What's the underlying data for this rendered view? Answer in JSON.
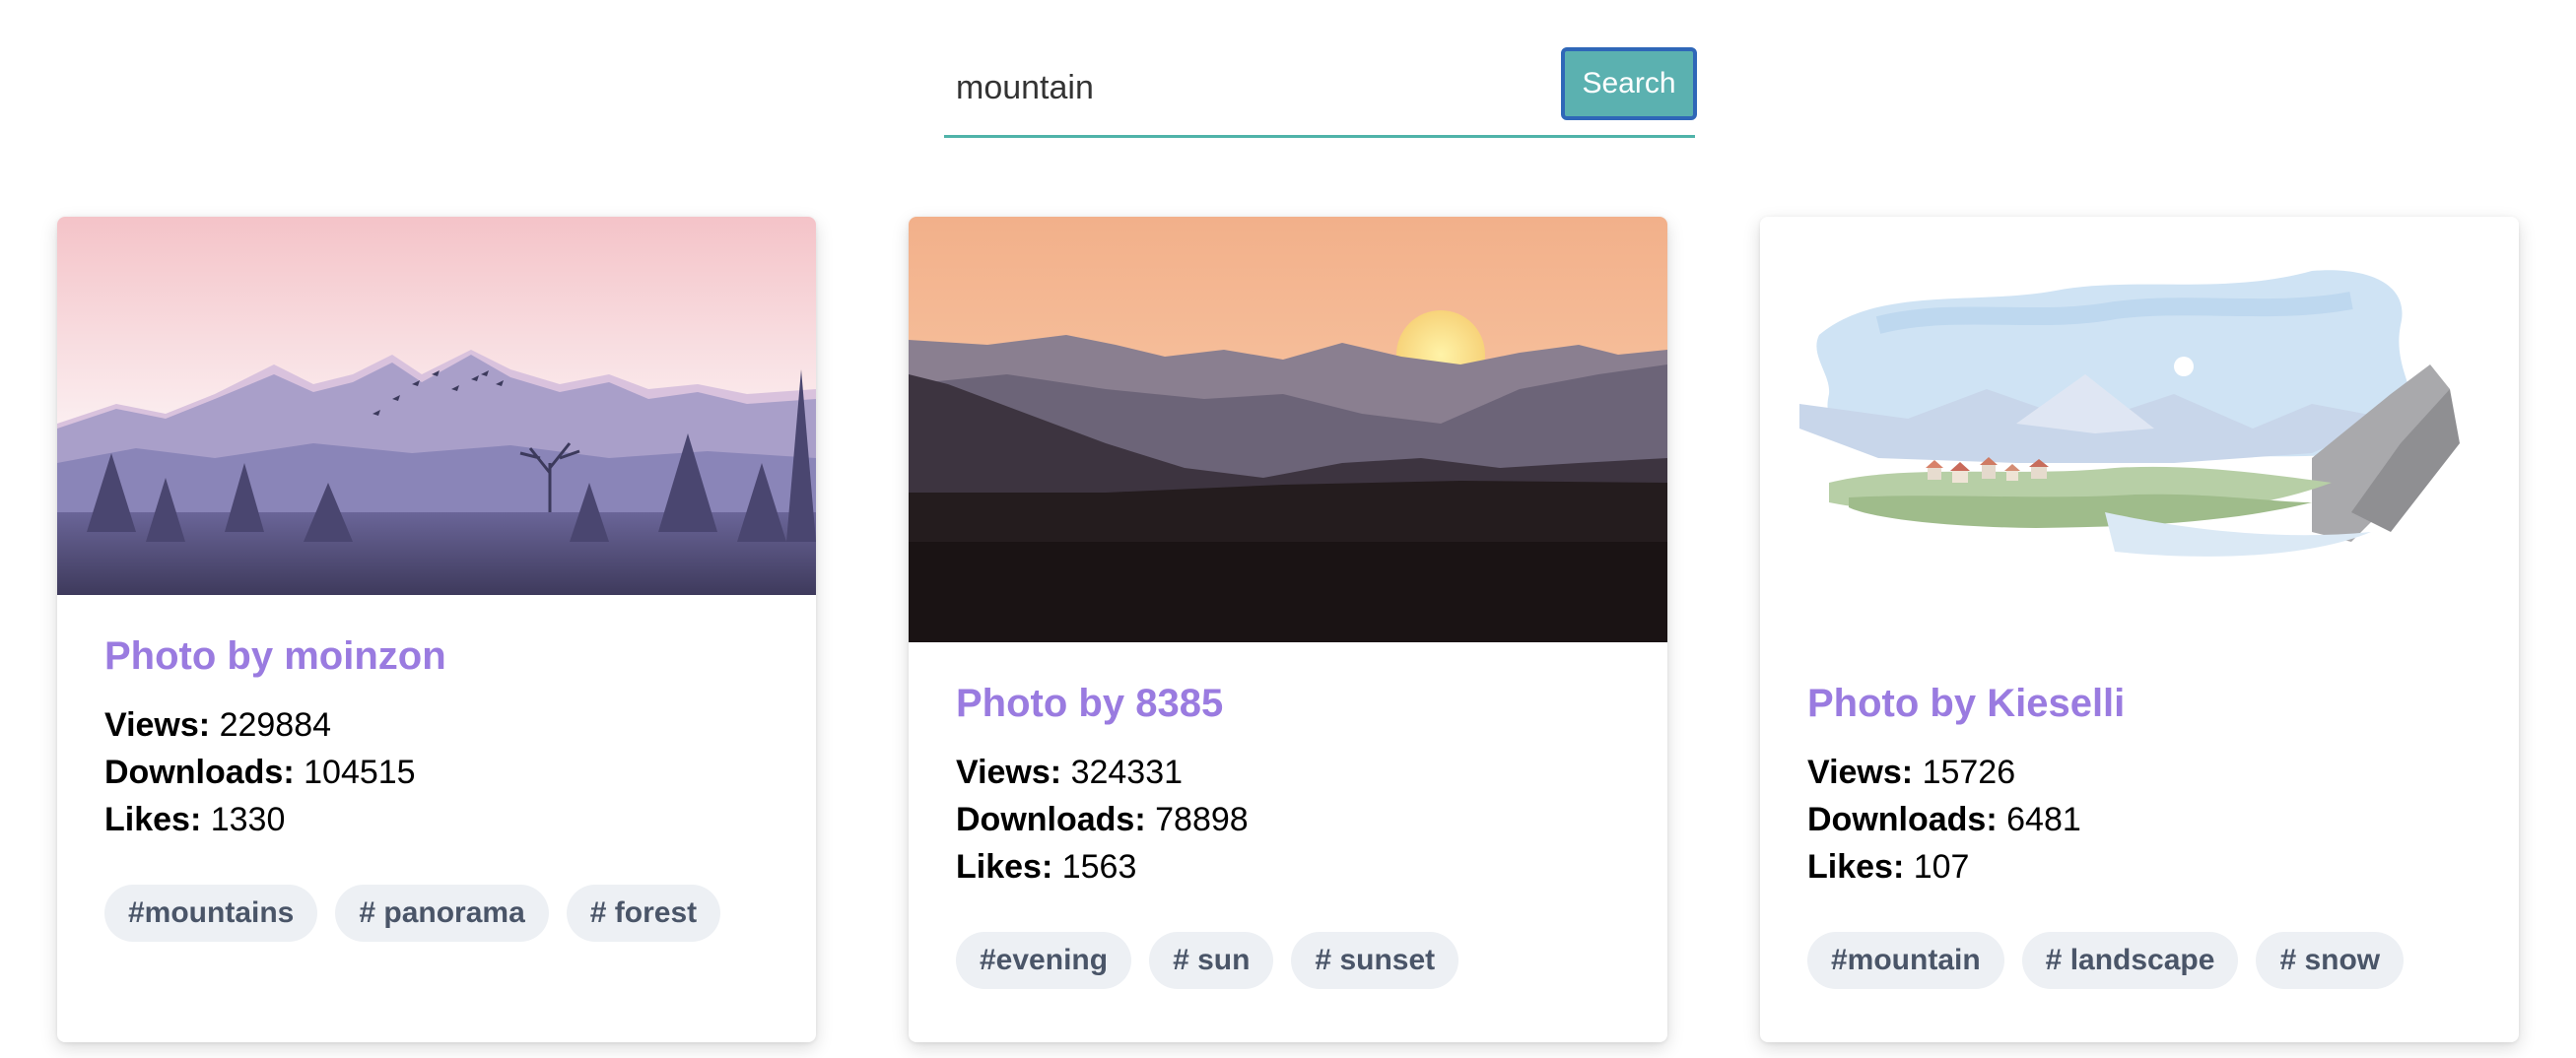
{
  "search": {
    "value": "mountain",
    "button_label": "Search"
  },
  "cards": [
    {
      "title": "Photo by moinzon",
      "views_label": "Views:",
      "views": "229884",
      "downloads_label": "Downloads:",
      "downloads": "104515",
      "likes_label": "Likes:",
      "likes": "1330",
      "tags": [
        "#mountains",
        "# panorama",
        "# forest"
      ]
    },
    {
      "title": "Photo by 8385",
      "views_label": "Views:",
      "views": "324331",
      "downloads_label": "Downloads:",
      "downloads": "78898",
      "likes_label": "Likes:",
      "likes": "1563",
      "tags": [
        "#evening",
        "# sun",
        "# sunset"
      ]
    },
    {
      "title": "Photo by Kieselli",
      "views_label": "Views:",
      "views": "15726",
      "downloads_label": "Downloads:",
      "downloads": "6481",
      "likes_label": "Likes:",
      "likes": "107",
      "tags": [
        "#mountain",
        "# landscape",
        "# snow"
      ]
    }
  ],
  "colors": {
    "accent_title": "#9a7be0",
    "search_button": "#5bb1b0",
    "search_underline": "#4fb3a9",
    "tag_bg": "#edf0f4"
  }
}
